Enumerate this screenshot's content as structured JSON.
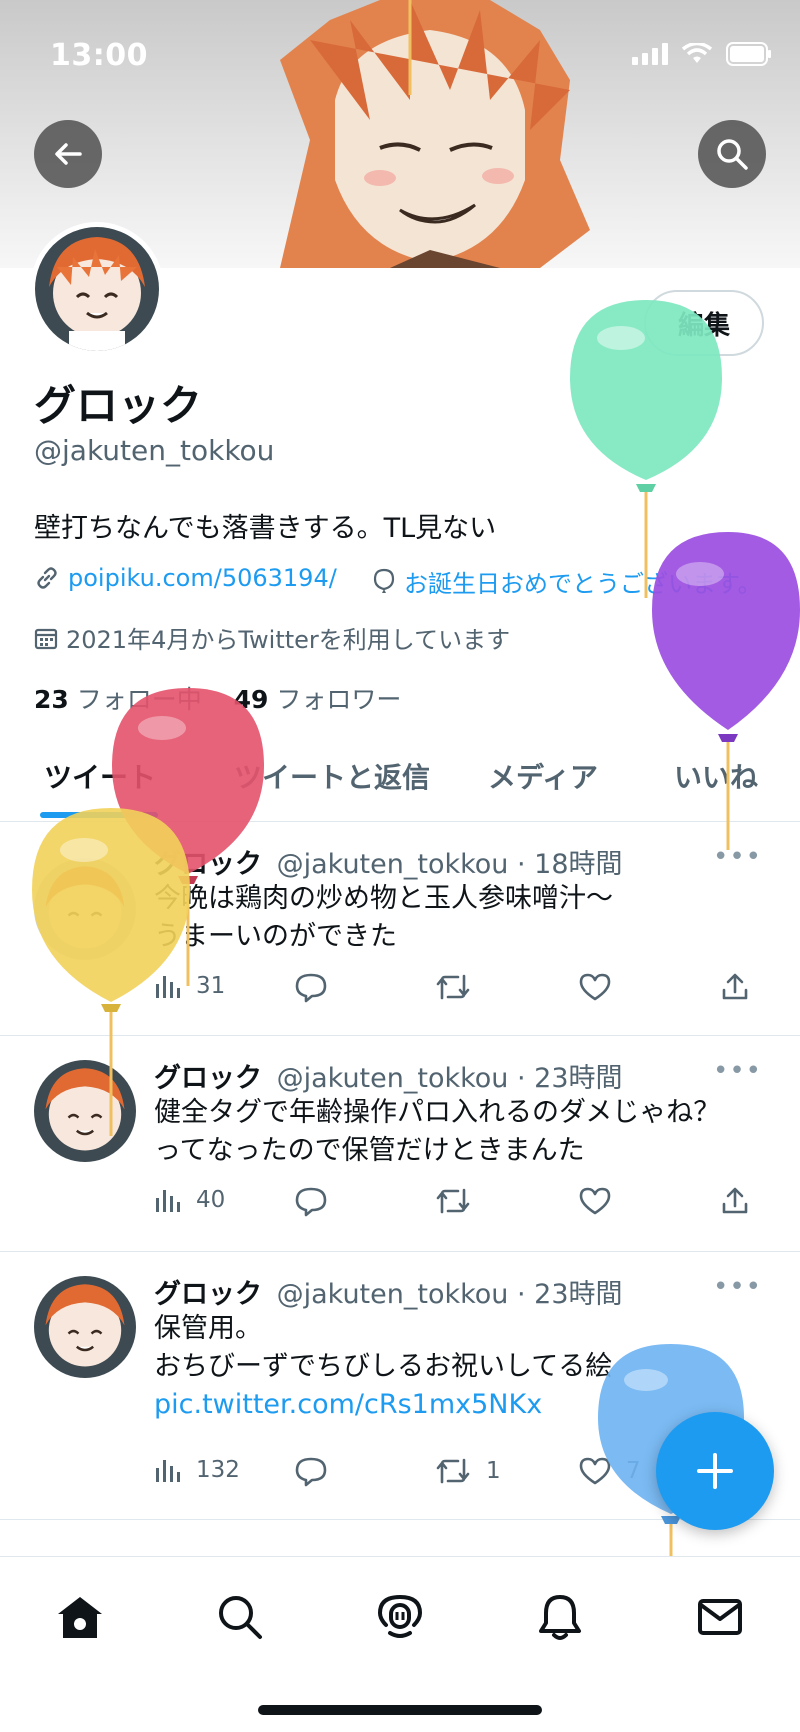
{
  "status_bar": {
    "time": "13:00"
  },
  "profile": {
    "display_name": "グロック",
    "handle": "@jakuten_tokkou",
    "bio": "壁打ちなんでも落書きする。TL見ない",
    "link": "poipiku.com/5063194/",
    "birthday_text": "お誕生日おめでとうございます。",
    "joined": "2021年4月からTwitterを利用しています",
    "following_count": "23",
    "following_label": "フォロー中",
    "followers_count": "49",
    "followers_label": "フォロワー",
    "edit_label": "編集"
  },
  "tabs": [
    {
      "label": "ツイート"
    },
    {
      "label": "ツイートと返信"
    },
    {
      "label": "メディア"
    },
    {
      "label": "いいね"
    }
  ],
  "tweets": [
    {
      "name": "グロック",
      "handle": "@jakuten_tokkou",
      "time": "· 18時間",
      "lines": [
        "今晩は鶏肉の炒め物と玉人参味噌汁〜",
        "うまーいのができた"
      ],
      "views": "31",
      "retweets": "",
      "likes": ""
    },
    {
      "name": "グロック",
      "handle": "@jakuten_tokkou",
      "time": "· 23時間",
      "lines": [
        "健全タグで年齢操作パロ入れるのダメじゃね？",
        "ってなったので保管だけときまんた"
      ],
      "views": "40",
      "retweets": "",
      "likes": ""
    },
    {
      "name": "グロック",
      "handle": "@jakuten_tokkou",
      "time": "· 23時間",
      "lines": [
        "保管用。",
        "おちびーずでちびしるお祝いしてる絵"
      ],
      "link": "pic.twitter.com/cRs1mx5NKx",
      "views": "132",
      "retweets": "1",
      "likes": "7"
    }
  ],
  "colors": {
    "accent": "#1d9bf0",
    "balloon_green": "#7ee8c0",
    "balloon_purple": "#9b4fe0",
    "balloon_red": "#e4526b",
    "balloon_yellow": "#f2d15a",
    "balloon_blue": "#6db3f2"
  }
}
